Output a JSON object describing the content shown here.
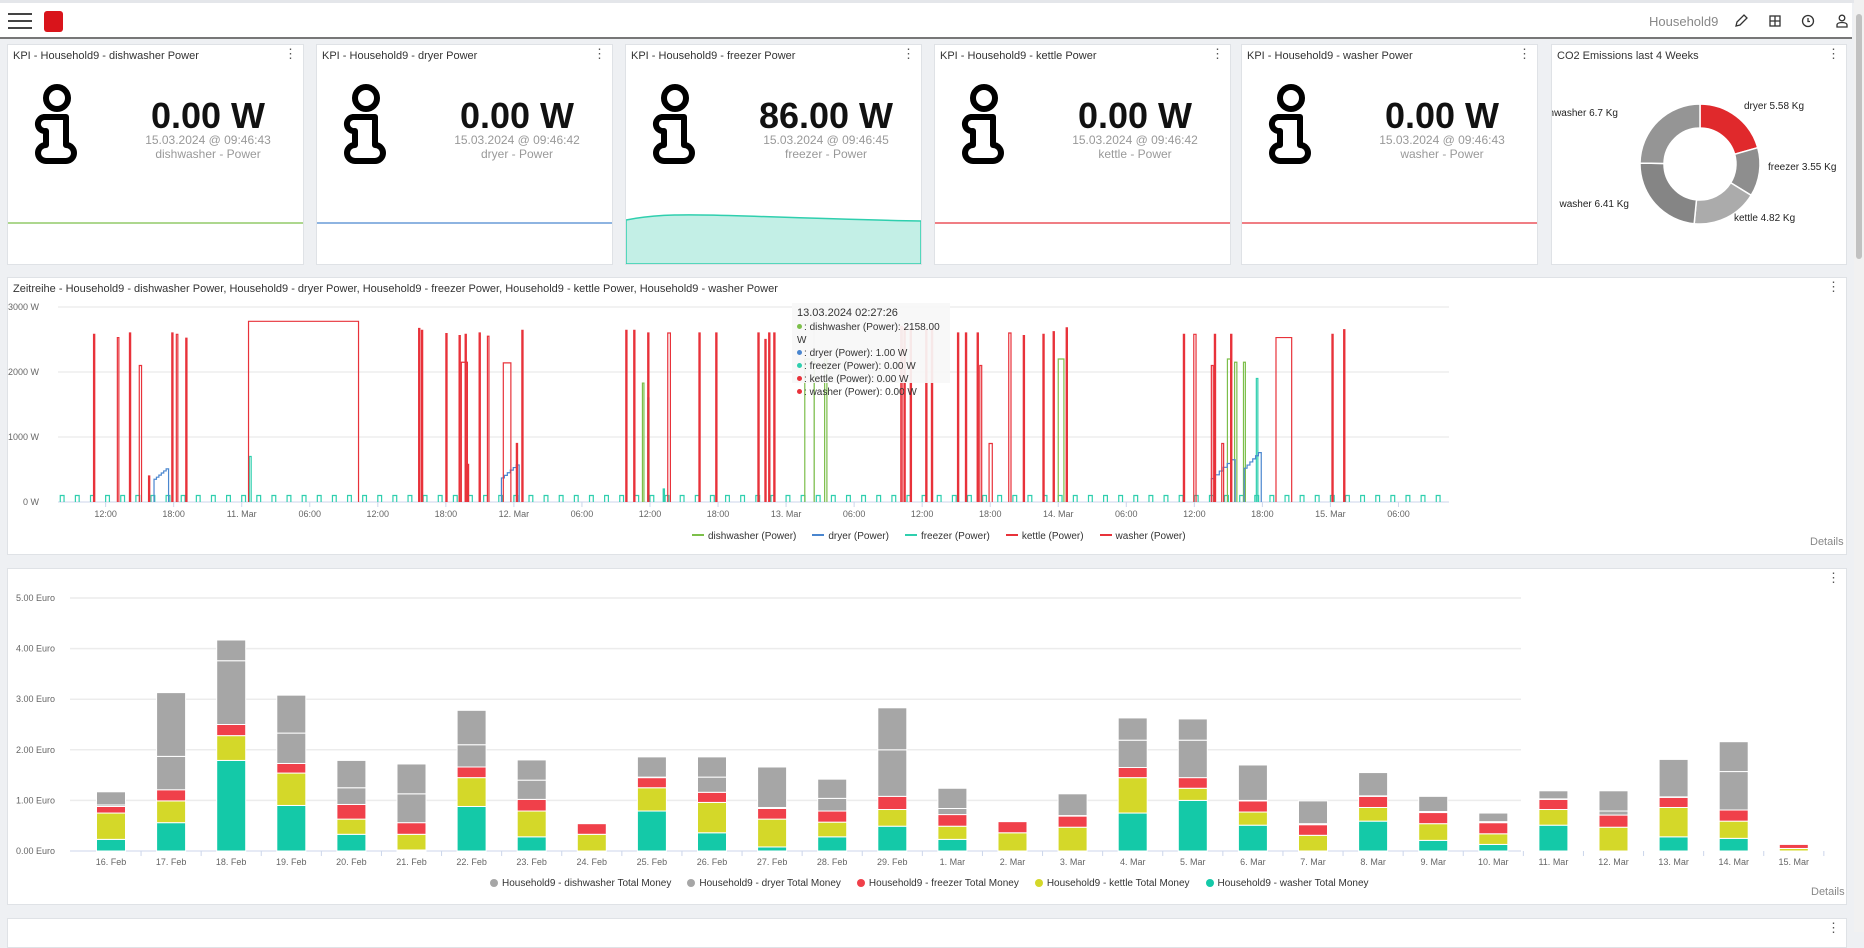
{
  "header": {
    "dashboard_name": "Household9",
    "icons": [
      "menu-icon",
      "logo",
      "edit-icon",
      "table-icon",
      "clock-icon",
      "user-icon"
    ]
  },
  "kpis": [
    {
      "title": "KPI - Household9 - dishwasher Power",
      "value": "0.00 W",
      "timestamp": "15.03.2024 @ 09:46:43",
      "label": "dishwasher - Power",
      "color": "#7cbf4a",
      "area": false
    },
    {
      "title": "KPI - Household9 - dryer Power",
      "value": "0.00 W",
      "timestamp": "15.03.2024 @ 09:46:42",
      "label": "dryer - Power",
      "color": "#4a86cf",
      "area": false
    },
    {
      "title": "KPI - Household9 - freezer Power",
      "value": "86.00 W",
      "timestamp": "15.03.2024 @ 09:46:45",
      "label": "freezer - Power",
      "color": "#2fcfae",
      "area": true
    },
    {
      "title": "KPI - Household9 - kettle Power",
      "value": "0.00 W",
      "timestamp": "15.03.2024 @ 09:46:42",
      "label": "kettle - Power",
      "color": "#e8323a",
      "area": false
    },
    {
      "title": "KPI - Household9 - washer Power",
      "value": "0.00 W",
      "timestamp": "15.03.2024 @ 09:46:43",
      "label": "washer - Power",
      "color": "#e8323a",
      "area": false
    }
  ],
  "co2": {
    "title": "CO2 Emissions last 4 Weeks",
    "chart_data": {
      "type": "pie",
      "donut": true,
      "unit": "Kg",
      "slices": [
        {
          "name": "dryer",
          "value": 5.58,
          "label": "dryer 5.58 Kg",
          "color": "#e0292c"
        },
        {
          "name": "freezer",
          "value": 3.55,
          "label": "freezer 3.55 Kg",
          "color": "#8e8e8e"
        },
        {
          "name": "kettle",
          "value": 4.82,
          "label": "kettle 4.82 Kg",
          "color": "#ababab"
        },
        {
          "name": "washer",
          "value": 6.41,
          "label": "washer 6.41 Kg",
          "color": "#858585"
        },
        {
          "name": "dishwasher",
          "value": 6.7,
          "label": "dishwasher 6.7 Kg",
          "color": "#959595"
        }
      ]
    }
  },
  "timeseries": {
    "title": "Zeitreihe - Household9 - dishwasher Power, Household9 - dryer Power, Household9 - freezer Power, Household9 - kettle Power, Household9 - washer Power",
    "details": "Details",
    "tooltip": {
      "title": "13.03.2024 02:27:26",
      "rows": [
        {
          "text": "dishwasher (Power): 2158.00 W",
          "color": "#7cbf4a"
        },
        {
          "text": "dryer (Power): 1.00 W",
          "color": "#4a86cf"
        },
        {
          "text": "freezer (Power): 0.00 W",
          "color": "#2fcfae"
        },
        {
          "text": "kettle (Power): 0.00 W",
          "color": "#e8323a"
        },
        {
          "text": "washer (Power): 0.00 W",
          "color": "#e8323a"
        }
      ]
    },
    "chart_data": {
      "type": "line",
      "step": true,
      "grid": true,
      "legend": "bottom",
      "x_range": [
        "2024-03-10T07:48",
        "2024-03-15T09:45"
      ],
      "ylim": [
        0,
        3000
      ],
      "yticks": [
        {
          "v": 0,
          "label": "0 W"
        },
        {
          "v": 1000,
          "label": "1000 W"
        },
        {
          "v": 2000,
          "label": "2000 W"
        },
        {
          "v": 3000,
          "label": "3000 W"
        }
      ],
      "xticks": [
        {
          "t": "2024-03-10T12:00",
          "label": "12:00"
        },
        {
          "t": "2024-03-10T18:00",
          "label": "18:00"
        },
        {
          "t": "2024-03-11T00:00",
          "label": "11. Mar"
        },
        {
          "t": "2024-03-11T06:00",
          "label": "06:00"
        },
        {
          "t": "2024-03-11T12:00",
          "label": "12:00"
        },
        {
          "t": "2024-03-11T18:00",
          "label": "18:00"
        },
        {
          "t": "2024-03-12T00:00",
          "label": "12. Mar"
        },
        {
          "t": "2024-03-12T06:00",
          "label": "06:00"
        },
        {
          "t": "2024-03-12T12:00",
          "label": "12:00"
        },
        {
          "t": "2024-03-12T18:00",
          "label": "18:00"
        },
        {
          "t": "2024-03-13T00:00",
          "label": "13. Mar"
        },
        {
          "t": "2024-03-13T06:00",
          "label": "06:00"
        },
        {
          "t": "2024-03-13T12:00",
          "label": "12:00"
        },
        {
          "t": "2024-03-13T18:00",
          "label": "18:00"
        },
        {
          "t": "2024-03-14T00:00",
          "label": "14. Mar"
        },
        {
          "t": "2024-03-14T06:00",
          "label": "06:00"
        },
        {
          "t": "2024-03-14T12:00",
          "label": "12:00"
        },
        {
          "t": "2024-03-14T18:00",
          "label": "18:00"
        },
        {
          "t": "2024-03-15T00:00",
          "label": "15. Mar"
        },
        {
          "t": "2024-03-15T06:00",
          "label": "06:00"
        }
      ],
      "cursor_time": "2024-03-13T02:27:26",
      "series": [
        {
          "name": "dishwasher (Power)",
          "color": "#7cbf4a",
          "pulses": [
            [
              "2024-03-12T11:20",
              "2024-03-12T11:28",
              1830
            ],
            [
              "2024-03-13T01:39",
              "2024-03-13T02:29",
              2200
            ],
            [
              "2024-03-13T03:24",
              "2024-03-13T03:36",
              2200
            ],
            [
              "2024-03-14T00:00",
              "2024-03-14T00:30",
              2200
            ],
            [
              "2024-03-14T14:55",
              "2024-03-14T15:12",
              2200
            ],
            [
              "2024-03-14T15:33",
              "2024-03-14T15:45",
              2150
            ],
            [
              "2024-03-14T16:20",
              "2024-03-14T16:30",
              2150
            ]
          ]
        },
        {
          "name": "dryer (Power)",
          "color": "#4a86cf",
          "ramps": [
            [
              "2024-03-10T16:16",
              "2024-03-10T17:33",
              350,
              510
            ],
            [
              "2024-03-11T22:54",
              "2024-03-12T00:28",
              370,
              570
            ],
            [
              "2024-03-14T13:30",
              "2024-03-14T15:36",
              360,
              650
            ],
            [
              "2024-03-14T16:24",
              "2024-03-14T17:54",
              520,
              760
            ]
          ]
        },
        {
          "name": "freezer (Power)",
          "color": "#2fcfae",
          "cycle_watts": 100,
          "cycle_days": [
            "2024-03-10",
            "2024-03-11",
            "2024-03-12",
            "2024-03-13",
            "2024-03-14",
            "2024-03-15"
          ],
          "cycle_start_times": [
            "00:00",
            "01:20",
            "02:40",
            "04:00",
            "05:20",
            "06:40",
            "08:00",
            "09:20",
            "10:40",
            "12:00",
            "13:20",
            "14:40",
            "16:00",
            "17:20",
            "18:40",
            "20:00",
            "21:20",
            "22:40"
          ],
          "pulses": [
            [
              "2024-03-11T00:40",
              "2024-03-11T00:50",
              700
            ],
            [
              "2024-03-12T11:48",
              "2024-03-12T11:55",
              1600
            ],
            [
              "2024-03-12T13:10",
              "2024-03-12T13:16",
              200
            ],
            [
              "2024-03-14T17:28",
              "2024-03-14T17:36",
              1900
            ]
          ]
        },
        {
          "name": "kettle (Power)",
          "color": "#e8323a",
          "pulses": [
            [
              "2024-03-10T10:56",
              "2024-03-10T11:02",
              2580
            ],
            [
              "2024-03-10T13:02",
              "2024-03-10T13:10",
              2530
            ],
            [
              "2024-03-10T14:06",
              "2024-03-10T14:10",
              2600
            ],
            [
              "2024-03-10T14:58",
              "2024-03-10T15:10",
              2100
            ],
            [
              "2024-03-10T15:47",
              "2024-03-10T15:51",
              400
            ],
            [
              "2024-03-10T17:50",
              "2024-03-10T17:55",
              2600
            ],
            [
              "2024-03-10T18:14",
              "2024-03-10T18:22",
              2580
            ],
            [
              "2024-03-10T19:04",
              "2024-03-10T19:08",
              2520
            ],
            [
              "2024-03-11T15:36",
              "2024-03-11T15:40",
              2670
            ],
            [
              "2024-03-11T15:51",
              "2024-03-11T15:55",
              2640
            ],
            [
              "2024-03-11T18:00",
              "2024-03-11T18:05",
              2590
            ],
            [
              "2024-03-11T19:10",
              "2024-03-11T19:16",
              2560
            ],
            [
              "2024-03-11T19:42",
              "2024-03-11T19:48",
              2580
            ],
            [
              "2024-03-11T20:56",
              "2024-03-11T21:00",
              2600
            ],
            [
              "2024-03-11T21:40",
              "2024-03-11T21:48",
              2550
            ],
            [
              "2024-03-12T00:42",
              "2024-03-12T00:46",
              2640
            ],
            [
              "2024-03-12T09:52",
              "2024-03-12T09:56",
              2640
            ],
            [
              "2024-03-12T10:34",
              "2024-03-12T10:38",
              2640
            ],
            [
              "2024-03-12T11:48",
              "2024-03-12T11:52",
              2600
            ],
            [
              "2024-03-12T13:34",
              "2024-03-12T13:48",
              2600
            ],
            [
              "2024-03-12T16:19",
              "2024-03-12T16:23",
              2600
            ],
            [
              "2024-03-12T17:48",
              "2024-03-12T17:52",
              2600
            ],
            [
              "2024-03-12T21:31",
              "2024-03-12T21:35",
              2600
            ],
            [
              "2024-03-12T22:08",
              "2024-03-12T22:12",
              2500
            ],
            [
              "2024-03-12T22:28",
              "2024-03-12T22:32",
              2600
            ],
            [
              "2024-03-12T22:55",
              "2024-03-12T22:59",
              2600
            ],
            [
              "2024-03-13T10:07",
              "2024-03-13T10:14",
              2700
            ],
            [
              "2024-03-13T10:24",
              "2024-03-13T10:28",
              2680
            ],
            [
              "2024-03-13T10:57",
              "2024-03-13T11:01",
              2670
            ],
            [
              "2024-03-13T12:19",
              "2024-03-13T12:23",
              2650
            ],
            [
              "2024-03-13T12:49",
              "2024-03-13T12:53",
              2660
            ],
            [
              "2024-03-13T15:07",
              "2024-03-13T15:12",
              2600
            ],
            [
              "2024-03-13T15:49",
              "2024-03-13T15:53",
              2600
            ],
            [
              "2024-03-13T16:51",
              "2024-03-13T16:55",
              2600
            ],
            [
              "2024-03-13T19:38",
              "2024-03-13T19:50",
              2600
            ],
            [
              "2024-03-13T20:55",
              "2024-03-13T20:59",
              2560
            ],
            [
              "2024-03-13T22:39",
              "2024-03-13T22:43",
              2580
            ],
            [
              "2024-03-13T23:33",
              "2024-03-13T23:37",
              2620
            ],
            [
              "2024-03-14T00:42",
              "2024-03-14T00:46",
              2680
            ],
            [
              "2024-03-14T11:02",
              "2024-03-14T11:06",
              2580
            ],
            [
              "2024-03-14T11:57",
              "2024-03-14T12:09",
              2580
            ],
            [
              "2024-03-14T13:46",
              "2024-03-14T13:50",
              2580
            ],
            [
              "2024-03-14T15:12",
              "2024-03-14T15:16",
              2580
            ],
            [
              "2024-03-15T00:08",
              "2024-03-15T00:12",
              2580
            ],
            [
              "2024-03-15T01:10",
              "2024-03-15T01:14",
              2650
            ]
          ]
        },
        {
          "name": "washer (Power)",
          "color": "#e8323a",
          "pulses": [
            [
              "2024-03-11T00:36",
              "2024-03-11T10:18",
              2780
            ],
            [
              "2024-03-11T19:22",
              "2024-03-11T19:54",
              2150
            ],
            [
              "2024-03-11T19:54",
              "2024-03-11T20:00",
              580
            ],
            [
              "2024-03-11T23:04",
              "2024-03-11T23:44",
              2140
            ],
            [
              "2024-03-12T00:13",
              "2024-03-12T00:17",
              900
            ],
            [
              "2024-03-13T17:05",
              "2024-03-13T17:15",
              2100
            ],
            [
              "2024-03-13T17:54",
              "2024-03-13T18:11",
              900
            ],
            [
              "2024-03-14T13:30",
              "2024-03-14T13:40",
              2100
            ],
            [
              "2024-03-14T14:25",
              "2024-03-14T14:35",
              900
            ],
            [
              "2024-03-14T19:12",
              "2024-03-14T20:35",
              2530
            ]
          ]
        }
      ]
    }
  },
  "money": {
    "details": "Details",
    "chart_data": {
      "type": "bar",
      "stacked": true,
      "grid": true,
      "legend": "bottom",
      "ylim": [
        0,
        5
      ],
      "yticks": [
        {
          "v": 0,
          "label": "0.00 Euro"
        },
        {
          "v": 1,
          "label": "1.00 Euro"
        },
        {
          "v": 2,
          "label": "2.00 Euro"
        },
        {
          "v": 3,
          "label": "3.00 Euro"
        },
        {
          "v": 4,
          "label": "4.00 Euro"
        },
        {
          "v": 5,
          "label": "5.00 Euro"
        }
      ],
      "categories": [
        "16. Feb",
        "17. Feb",
        "18. Feb",
        "19. Feb",
        "20. Feb",
        "21. Feb",
        "22. Feb",
        "23. Feb",
        "24. Feb",
        "25. Feb",
        "26. Feb",
        "27. Feb",
        "28. Feb",
        "29. Feb",
        "1. Mar",
        "2. Mar",
        "3. Mar",
        "4. Mar",
        "5. Mar",
        "6. Mar",
        "7. Mar",
        "8. Mar",
        "9. Mar",
        "10. Mar",
        "11. Mar",
        "12. Mar",
        "13. Mar",
        "14. Mar",
        "15. Mar"
      ],
      "series": [
        {
          "name": "Household9 - washer Total Money",
          "color": "#14c9a8",
          "values": [
            0.23,
            0.56,
            1.79,
            0.9,
            0.33,
            0.02,
            0.88,
            0.28,
            0,
            0.79,
            0.36,
            0.08,
            0.28,
            0.49,
            0.23,
            0,
            0,
            0.75,
            1.0,
            0.51,
            0,
            0.59,
            0.21,
            0.13,
            0.51,
            0,
            0.28,
            0.25,
            0
          ]
        },
        {
          "name": "Household9 - kettle Total Money",
          "color": "#d4d829",
          "values": [
            0.52,
            0.43,
            0.49,
            0.64,
            0.3,
            0.31,
            0.57,
            0.51,
            0.33,
            0.46,
            0.6,
            0.55,
            0.29,
            0.33,
            0.26,
            0.36,
            0.47,
            0.7,
            0.24,
            0.26,
            0.31,
            0.27,
            0.33,
            0.21,
            0.31,
            0.47,
            0.58,
            0.34,
            0.05
          ]
        },
        {
          "name": "Household9 - freezer Total Money",
          "color": "#f0404a",
          "values": [
            0.13,
            0.22,
            0.22,
            0.19,
            0.29,
            0.23,
            0.21,
            0.23,
            0.21,
            0.2,
            0.2,
            0.21,
            0.22,
            0.26,
            0.23,
            0.22,
            0.22,
            0.2,
            0.21,
            0.22,
            0.21,
            0.22,
            0.22,
            0.22,
            0.2,
            0.24,
            0.2,
            0.22,
            0.08
          ]
        },
        {
          "name": "Household9 - dryer Total Money",
          "color": "#a6a6a6",
          "values": [
            0.03,
            0.66,
            1.26,
            0.6,
            0.33,
            0.57,
            0.44,
            0.38,
            0,
            0.01,
            0.3,
            0.02,
            0.25,
            0.92,
            0.12,
            0,
            0.01,
            0.54,
            0.74,
            0.01,
            0.02,
            0.01,
            0.02,
            0.02,
            0.01,
            0.08,
            0.01,
            0.76,
            0
          ]
        },
        {
          "name": "Household9 - dishwasher Total Money",
          "color": "#a6a6a6",
          "values": [
            0.26,
            1.26,
            0.41,
            0.75,
            0.54,
            0.59,
            0.68,
            0.4,
            0,
            0.4,
            0.4,
            0.8,
            0.38,
            0.83,
            0.4,
            0,
            0.43,
            0.44,
            0.42,
            0.7,
            0.45,
            0.46,
            0.3,
            0.17,
            0.16,
            0.4,
            0.74,
            0.59,
            0
          ]
        }
      ],
      "legend_order": [
        "Household9 - dishwasher Total Money",
        "Household9 - dryer Total Money",
        "Household9 - freezer Total Money",
        "Household9 - kettle Total Money",
        "Household9 - washer Total Money"
      ]
    }
  }
}
